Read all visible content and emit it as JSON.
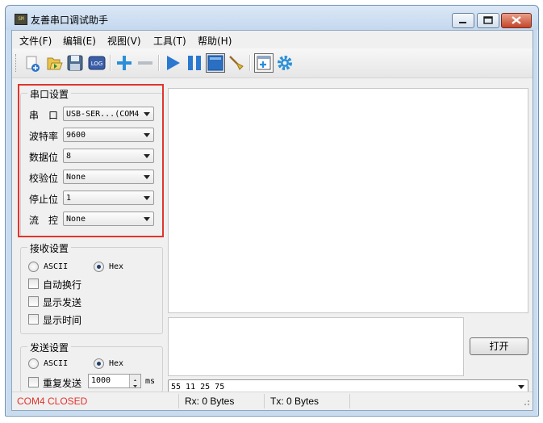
{
  "window": {
    "title": "友善串口调试助手",
    "app_icon_text": "SM"
  },
  "menu": [
    {
      "label": "文件(F)"
    },
    {
      "label": "编辑(E)"
    },
    {
      "label": "视图(V)"
    },
    {
      "label": "工具(T)"
    },
    {
      "label": "帮助(H)"
    }
  ],
  "toolbar": {
    "log_label": "LOG",
    "icons": [
      "new-icon",
      "open-icon",
      "save-icon",
      "log-icon",
      "add-icon",
      "remove-icon",
      "play-icon",
      "pause-icon",
      "window-icon",
      "broom-icon",
      "add-window-icon",
      "gear-icon"
    ]
  },
  "serial": {
    "title": "串口设置",
    "port_label": "串　口",
    "port_value": "USB-SER...(COM4",
    "baud_label": "波特率",
    "baud_value": "9600",
    "data_label": "数据位",
    "data_value": "8",
    "parity_label": "校验位",
    "parity_value": "None",
    "stop_label": "停止位",
    "stop_value": "1",
    "flow_label": "流　控",
    "flow_value": "None"
  },
  "receive": {
    "title": "接收设置",
    "ascii": "ASCII",
    "hex": "Hex",
    "selected": "Hex",
    "auto_wrap": "自动换行",
    "show_send": "显示发送",
    "show_time": "显示时间"
  },
  "send": {
    "title": "发送设置",
    "ascii": "ASCII",
    "hex": "Hex",
    "selected": "Hex",
    "repeat": "重复发送",
    "interval": "1000",
    "unit": "ms"
  },
  "open_button": "打开",
  "send_input": "55 11 25 75",
  "status": {
    "port": "COM4 CLOSED",
    "rx": "Rx: 0 Bytes",
    "tx": "Tx: 0 Bytes",
    "port_color": "#e0342d"
  },
  "colors": {
    "accent_blue": "#2a73c9",
    "highlight_red": "#e0342d",
    "title_bg": "#c9dcef"
  }
}
